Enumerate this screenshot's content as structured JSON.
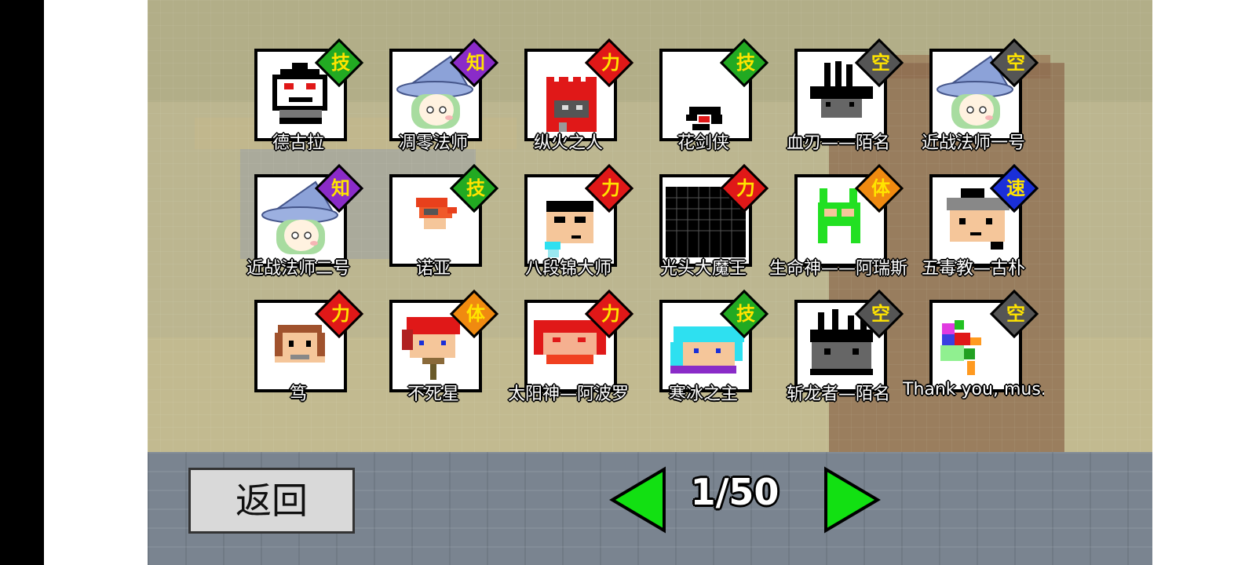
{
  "navigation": {
    "back_label": "返回",
    "page_indicator": "1/50"
  },
  "attribute_colors": {
    "技": "#22aa22",
    "知": "#8a2bc8",
    "力": "#e01818",
    "空": "#555555",
    "体": "#f08a10",
    "速": "#1a2fd8"
  },
  "characters": [
    {
      "name": "德古拉",
      "attribute": "技",
      "portrait_icon": "dracula-portrait-icon"
    },
    {
      "name": "凋零法师",
      "attribute": "知",
      "portrait_icon": "witch-mage-portrait-icon"
    },
    {
      "name": "纵火之人",
      "attribute": "力",
      "portrait_icon": "arsonist-portrait-icon"
    },
    {
      "name": "花剑侠",
      "attribute": "技",
      "portrait_icon": "flower-swordsman-portrait-icon"
    },
    {
      "name": "血刃——陌名",
      "attribute": "空",
      "portrait_icon": "bloodblade-portrait-icon"
    },
    {
      "name": "近战法师一号",
      "attribute": "空",
      "portrait_icon": "witch-mage-portrait-icon"
    },
    {
      "name": "近战法师二号",
      "attribute": "知",
      "portrait_icon": "witch-mage-portrait-icon"
    },
    {
      "name": "诺亚",
      "attribute": "技",
      "portrait_icon": "noah-portrait-icon"
    },
    {
      "name": "八段锦大师",
      "attribute": "力",
      "portrait_icon": "baduanjin-master-portrait-icon"
    },
    {
      "name": "光头大魔王",
      "attribute": "力",
      "portrait_icon": "bald-demon-king-portrait-icon"
    },
    {
      "name": "生命神——阿瑞斯",
      "attribute": "体",
      "portrait_icon": "life-god-portrait-icon"
    },
    {
      "name": "五毒教—古朴",
      "attribute": "速",
      "portrait_icon": "five-poison-portrait-icon"
    },
    {
      "name": "笃",
      "attribute": "力",
      "portrait_icon": "du-portrait-icon"
    },
    {
      "name": "不死星",
      "attribute": "体",
      "portrait_icon": "undying-star-portrait-icon"
    },
    {
      "name": "太阳神—阿波罗",
      "attribute": "力",
      "portrait_icon": "sun-god-portrait-icon"
    },
    {
      "name": "寒冰之主",
      "attribute": "技",
      "portrait_icon": "ice-lord-portrait-icon"
    },
    {
      "name": "斩龙者—陌名",
      "attribute": "空",
      "portrait_icon": "dragon-slayer-portrait-icon"
    },
    {
      "name": "Thank you, mus.",
      "attribute": "空",
      "portrait_icon": "parrot-portrait-icon"
    }
  ]
}
